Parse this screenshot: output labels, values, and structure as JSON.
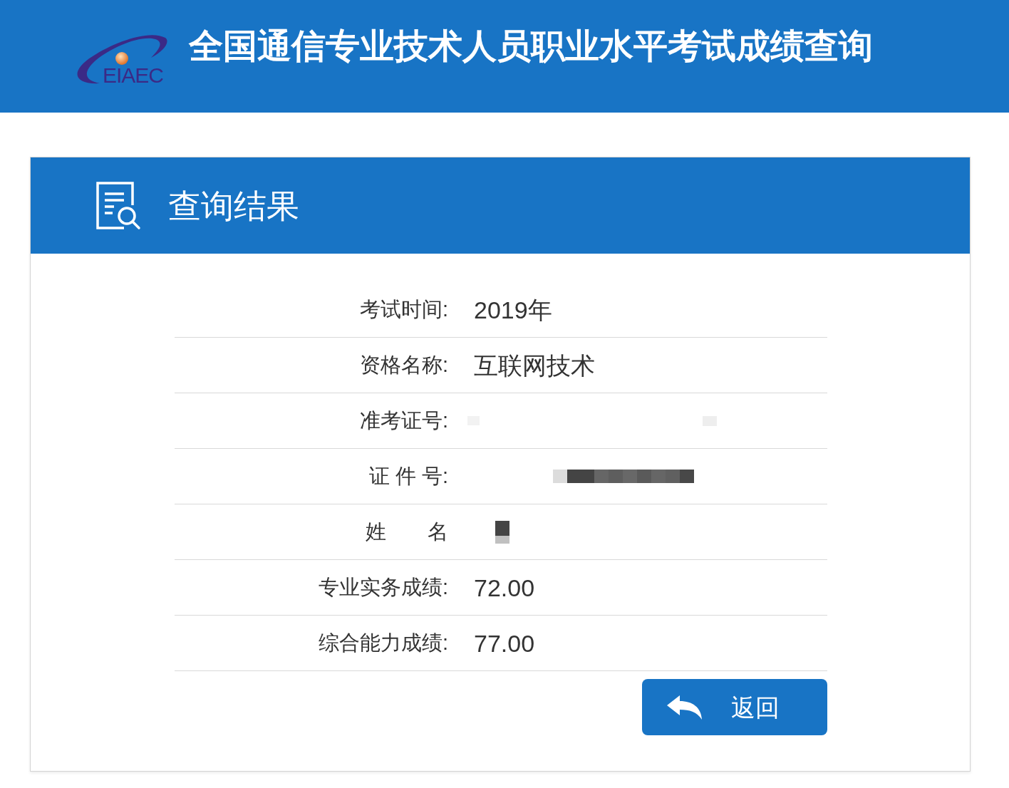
{
  "header": {
    "logo_text": "EIAEC",
    "title": "全国通信专业技术人员职业水平考试成绩查询"
  },
  "card": {
    "title": "查询结果"
  },
  "rows": [
    {
      "label": "考试时间:",
      "kind": "text",
      "value": "2019年"
    },
    {
      "label": "资格名称:",
      "kind": "text",
      "value": "互联网技术"
    },
    {
      "label": "准考证号:",
      "kind": "blurred"
    },
    {
      "label": "证 件 号:",
      "kind": "masked"
    },
    {
      "label": "姓　　名",
      "kind": "blot"
    },
    {
      "label": "专业实务成绩:",
      "kind": "text",
      "value": "72.00"
    },
    {
      "label": "综合能力成绩:",
      "kind": "text",
      "value": "77.00"
    }
  ],
  "button": {
    "label": "返回"
  }
}
